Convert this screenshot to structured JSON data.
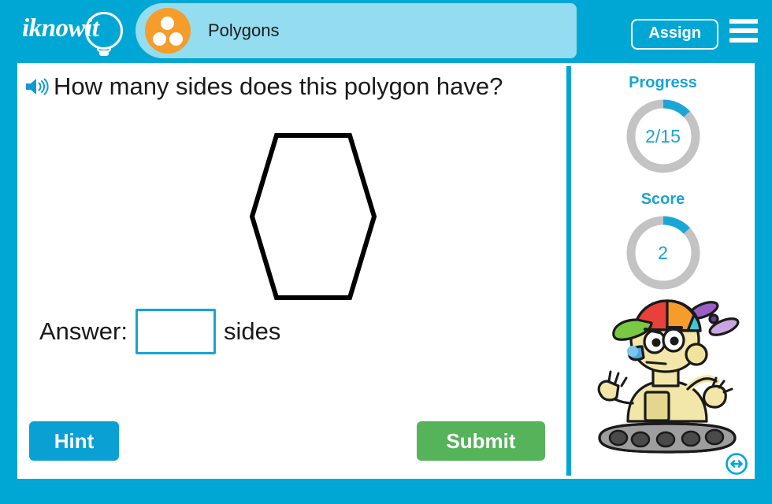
{
  "header": {
    "logo_text": "iknowit",
    "logo_icon": "lightbulb-icon",
    "topic_title": "Polygons",
    "topic_icon": "three-dots-circle-icon",
    "assign_label": "Assign",
    "menu_icon": "hamburger-menu-icon",
    "bar_color": "#00a7d5",
    "tab_color": "#94dcf0",
    "topic_icon_color": "#f59c2b"
  },
  "question": {
    "speaker_icon": "speaker-audio-icon",
    "text": "How many sides does this polygon have?"
  },
  "shape": {
    "name": "hexagon",
    "sides": 6,
    "stroke_color": "#000000",
    "fill_color": "#ffffff"
  },
  "answer": {
    "prefix_label": "Answer:",
    "suffix_label": "sides",
    "value": "",
    "placeholder": "",
    "border_color": "#19a3d6"
  },
  "actions": {
    "hint_label": "Hint",
    "hint_color": "#0aa0d4",
    "submit_label": "Submit",
    "submit_color": "#55b35a"
  },
  "sidebar": {
    "progress": {
      "label": "Progress",
      "value_text": "2/15",
      "current": 2,
      "total": 15,
      "percent": 13,
      "arc_color": "#1aa7d8",
      "track_color": "#c3c3c3"
    },
    "score": {
      "label": "Score",
      "value_text": "2",
      "value": 2,
      "percent": 13,
      "arc_color": "#1aa7d8",
      "track_color": "#c3c3c3"
    },
    "mascot_icon": "robot-mascot-image",
    "resize_icon": "resize-horizontal-icon"
  }
}
